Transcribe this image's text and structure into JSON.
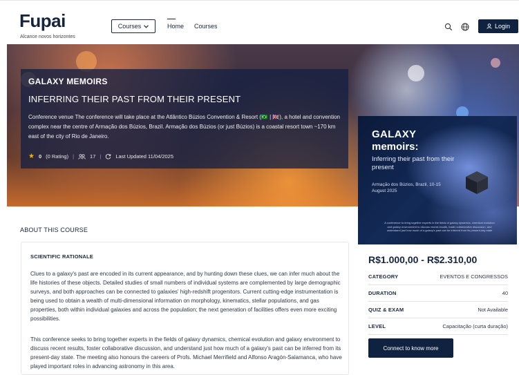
{
  "header": {
    "logo": "Fupai",
    "tagline": "Alcance novos horizontes",
    "courses_button": "Courses",
    "nav": [
      {
        "label": "Home"
      },
      {
        "label": "Courses"
      }
    ],
    "login_label": "Login"
  },
  "hero": {
    "title": "GALAXY MEMOIRS",
    "subtitle": "INFERRING THEIR PAST FROM THEIR PRESENT",
    "description": "Conference venue The conference will take place at the Atlântico Búzios Convention & Resort (🇧🇷 | 🇬🇧), a hotel and convention complex near the centre of Armação dos Búzios, Brazil. Armação dos Búzios (or just Búzios) is a coastal resort town ~170 km east of the city of Rio de Janeiro.",
    "rating_value": "0",
    "rating_label": "(0 Rating)",
    "students": "17",
    "last_updated": "Last Updated 11/04/2025"
  },
  "about": {
    "heading": "ABOUT THIS COURSE",
    "section_title": "SCIENTIFIC RATIONALE",
    "paragraph1": "Clues to a galaxy's past are encoded in its current appearance, and by hunting down these clues, we can infer much about the life histories of these objects. Detailed studies of small numbers of individual systems are complemented by large demographic surveys, and both approaches can be connected to galaxies' high-redshift progenitors. Current cutting-edge instrumentation is being used to obtain a wealth of multi-dimensional information on morphology, kinematics, stellar populations, and gas properties, both within individual galaxies and across the population; the next generation of facilities offers even more exciting possibilities.",
    "paragraph2": "This conference seeks to bring together experts in the fields of galaxy dynamics, chemical evolution and galaxy environment to discuss recent results, foster collaborative discussion, and understand just how much of a galaxy's past can be inferred from its present-day state. The meeting also honours the careers of Profs. Michael Merrifield and Alfonso Aragón-Salamanca, who have played important roles in advancing astronomy in this area."
  },
  "sidebar": {
    "poster_line1": "GALAXY",
    "poster_line2": "memoirs:",
    "poster_line3": "Inferring their past from their present",
    "poster_location": "Armação dos Búzios, Brazil, 10-15 August 2025",
    "poster_footer": "A conference to bring together experts in the fields of galaxy dynamics, chemical evolution and galaxy environment to discuss recent results, foster collaborative discussion, and understand just how much of a galaxy's past can be inferred from its present-day state",
    "price": "R$1.000,00 - R$2.310,00",
    "info": [
      {
        "label": "CATEGORY",
        "value": "EVENTOS E CONGRESSOS"
      },
      {
        "label": "DURATION",
        "value": "40"
      },
      {
        "label": "QUIZ & EXAM",
        "value": "Not Available"
      },
      {
        "label": "LEVEL",
        "value": "Capacitação (curta duração)"
      }
    ],
    "connect_label": "Connect to know more"
  }
}
